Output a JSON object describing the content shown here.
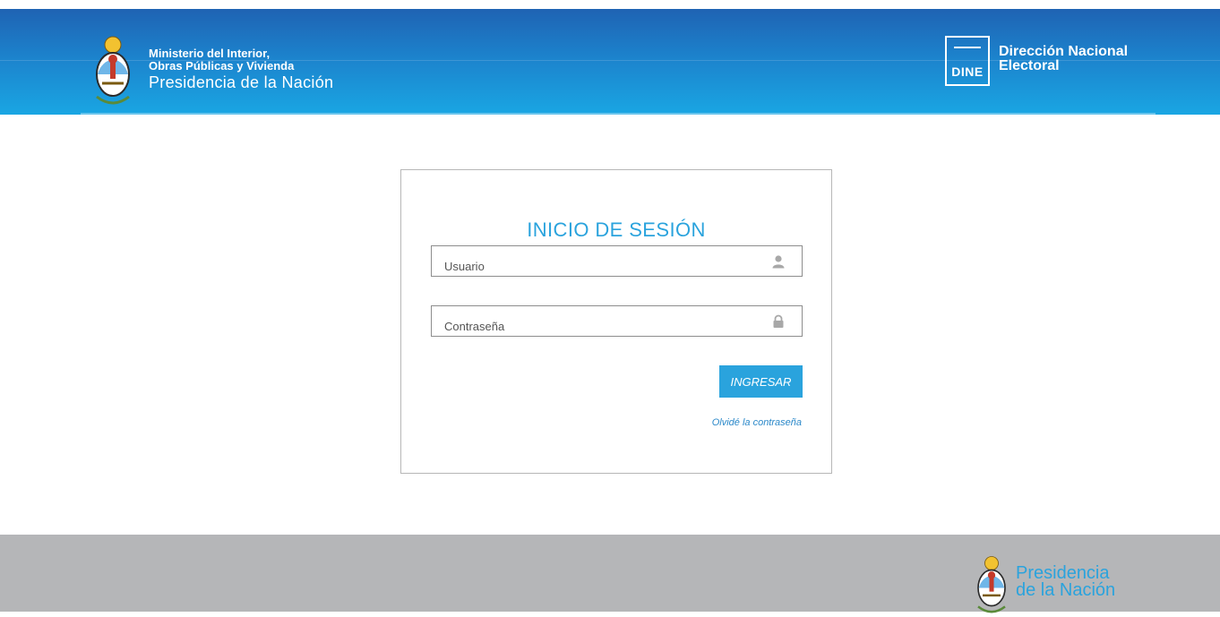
{
  "header": {
    "ministry_line1": "Ministerio del Interior,",
    "ministry_line2": "Obras Públicas y Vivienda",
    "ministry_line3": "Presidencia de la Nación",
    "dine_badge": "DINE",
    "dine_line1": "Dirección Nacional",
    "dine_line2": "Electoral"
  },
  "login": {
    "title": "INICIO DE SESIÓN",
    "username_placeholder": "Usuario",
    "username_value": "",
    "password_placeholder": "Contraseña",
    "password_value": "",
    "submit_label": "INGRESAR",
    "forgot_label": "Olvidé la contraseña"
  },
  "footer": {
    "line1": "Presidencia",
    "line2": "de la Nación"
  },
  "icons": {
    "username": "user-icon",
    "password": "lock-icon",
    "crest": "argentine-coat-of-arms-icon"
  },
  "colors": {
    "header_top": "#1f63b3",
    "header_bottom": "#1aa6e3",
    "accent": "#2aa3dd",
    "footer_bg": "#b5b6b8"
  }
}
